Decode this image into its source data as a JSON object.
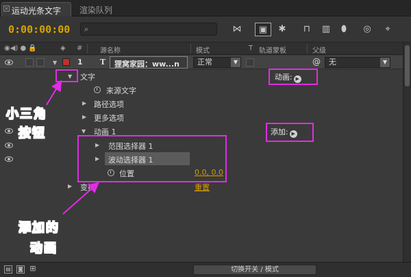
{
  "tabs": [
    {
      "label": "运动光条文字",
      "active": true
    },
    {
      "label": "渲染队列",
      "active": false
    }
  ],
  "toolbar": {
    "timecode": "0:00:00:00",
    "search_placeholder": "",
    "tools": [
      "composition-mini-flowchart-icon",
      "draft-3d-icon",
      "hide-shy-layers-icon",
      "frame-blending-icon",
      "motion-blur-icon",
      "brainstorm-icon",
      "auto-keyframe-icon",
      "graph-editor-icon"
    ]
  },
  "columns": {
    "hash": "#",
    "source_name": "源名称",
    "mode": "模式",
    "t": "T",
    "track_matte": "轨道蒙板",
    "parent": "父级"
  },
  "layer": {
    "number": "1",
    "type_icon": "T",
    "name": "狸窝家园：ww...n",
    "mode": "正常",
    "parent": "无",
    "label_color": "#c0302a"
  },
  "properties": {
    "text": "文字",
    "animate_button": "动画:",
    "source_text": "来源文字",
    "path_options": "路径选项",
    "more_options": "更多选项",
    "animator": "动画 1",
    "add_button": "添加:",
    "range_selector": "范围选择器 1",
    "wiggly_selector": "波动选择器 1",
    "position": "位置",
    "position_value": "0.0, 0.0",
    "transform": "变换",
    "reset": "重置"
  },
  "annotations": {
    "triangle_button": [
      "小三角",
      "按钮"
    ],
    "added_animation": [
      "添加的",
      "动画"
    ]
  },
  "footer": {
    "toggle_label": "切换开关 / 模式"
  },
  "colors": {
    "timecode": "#d7a300",
    "highlight": "#e22ce6",
    "label_red": "#c0302a",
    "value_orange": "#d29d00"
  }
}
